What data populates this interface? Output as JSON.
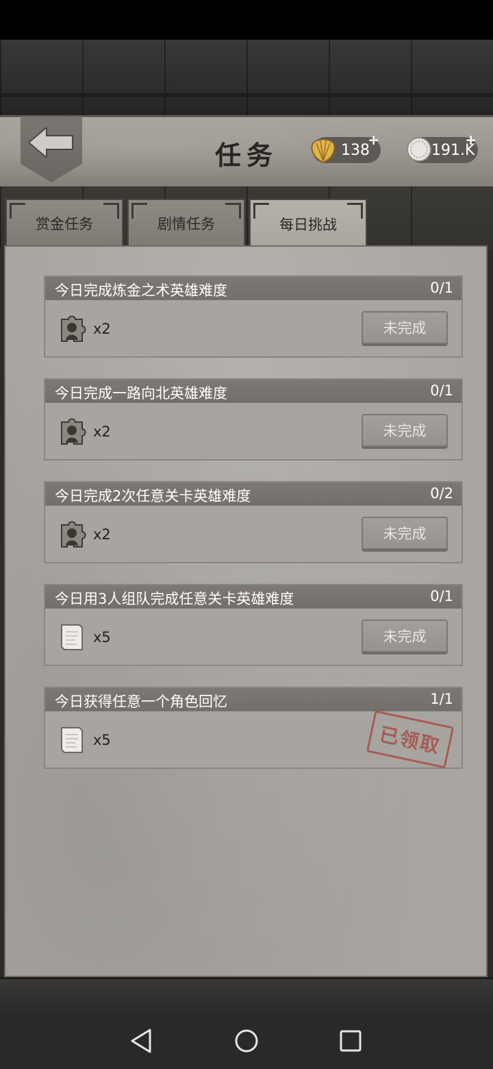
{
  "header": {
    "title": "任务",
    "shells": "138",
    "coins": "191.K"
  },
  "tabs": [
    {
      "label": "赏金任务"
    },
    {
      "label": "剧情任务"
    },
    {
      "label": "每日挑战"
    }
  ],
  "tasks": [
    {
      "title": "今日完成炼金之术英雄难度",
      "progress": "0/1",
      "reward_icon": "puzzle-portrait-icon",
      "qty": "x2",
      "status": "未完成"
    },
    {
      "title": "今日完成一路向北英雄难度",
      "progress": "0/1",
      "reward_icon": "puzzle-portrait-icon",
      "qty": "x2",
      "status": "未完成"
    },
    {
      "title": "今日完成2次任意关卡英雄难度",
      "progress": "0/2",
      "reward_icon": "puzzle-portrait-icon",
      "qty": "x2",
      "status": "未完成"
    },
    {
      "title": "今日用3人组队完成任意关卡英雄难度",
      "progress": "0/1",
      "reward_icon": "paper-scroll-icon",
      "qty": "x5",
      "status": "未完成"
    },
    {
      "title": "今日获得任意一个角色回忆",
      "progress": "1/1",
      "reward_icon": "paper-scroll-icon",
      "qty": "x5",
      "status": "已领取"
    }
  ]
}
